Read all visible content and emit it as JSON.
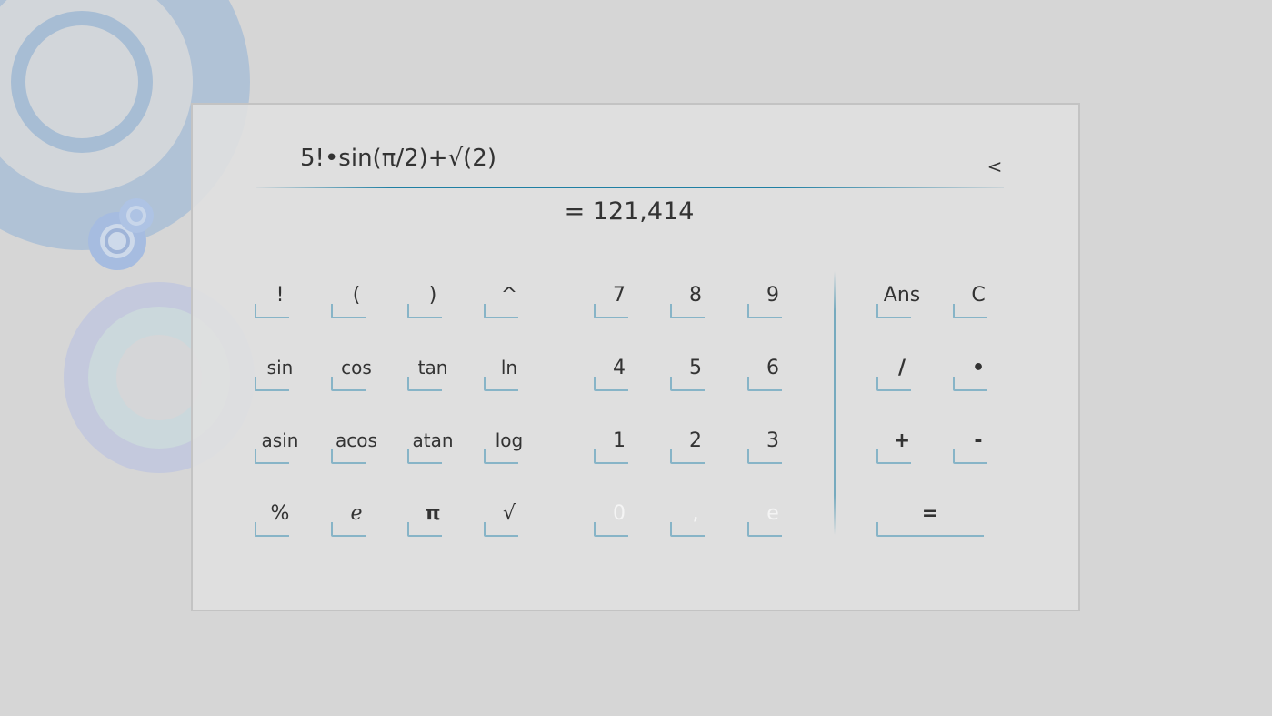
{
  "display": {
    "expression": "5!•sin(π/2)+√(2)",
    "result": "= 121,414",
    "back_label": "<"
  },
  "keys": {
    "factorial": "!",
    "open_paren": "(",
    "close_paren": ")",
    "power": "^",
    "sin": "sin",
    "cos": "cos",
    "tan": "tan",
    "ln": "ln",
    "asin": "asin",
    "acos": "acos",
    "atan": "atan",
    "log": "log",
    "percent": "%",
    "euler": "e",
    "pi": "π",
    "sqrt": "√",
    "d7": "7",
    "d8": "8",
    "d9": "9",
    "d4": "4",
    "d5": "5",
    "d6": "6",
    "d1": "1",
    "d2": "2",
    "d3": "3",
    "d0": "0",
    "comma": ",",
    "exp": "e",
    "ans": "Ans",
    "clear": "C",
    "divide": "/",
    "multiply": "•",
    "plus": "+",
    "minus": "-",
    "equals": "="
  }
}
